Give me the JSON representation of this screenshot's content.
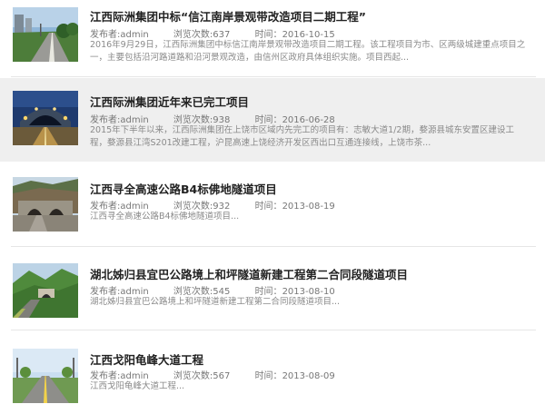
{
  "articles": [
    {
      "title": "江西际洲集团中标“信江南岸景观带改造项目二期工程”",
      "author_label": "发布者:",
      "author": "admin",
      "views_label": "浏览次数:",
      "views": "637",
      "time_label": "时间：",
      "date": "2016-10-15",
      "desc_line1": "2016年9月29日，江西际洲集团中标信江南岸景观带改造项目二期工程。该工程项目为市、区两级城建重点项目之",
      "desc_line2": "一，主要包括沿河路道路和沿河景观改造，由信州区政府具体组织实施。项目西起...",
      "thumb_icon": "boulevard-photo"
    },
    {
      "title": "江西际洲集团近年来已完工项目",
      "author_label": "发布者:",
      "author": "admin",
      "views_label": "浏览次数:",
      "views": "938",
      "time_label": "时间：",
      "date": "2016-06-28",
      "desc_line1": "2015年下半年以来，江西际洲集团在上饶市区域内先完工的项目有：志敏大道1/2期，婺源县城东安置区建设工",
      "desc_line2": "程，婺源县江湾S201改建工程，沪昆高速上饶经济开发区西出口互通连接线，上饶市茶...",
      "thumb_icon": "tunnel-night-photo"
    },
    {
      "title": "江西寻全高速公路B4标佛地隧道项目",
      "author_label": "发布者:",
      "author": "admin",
      "views_label": "浏览次数:",
      "views": "932",
      "time_label": "时间：",
      "date": "2013-08-19",
      "desc_line1": "江西寻全高速公路B4标佛地隧道项目...",
      "thumb_icon": "tunnel-portal-photo"
    },
    {
      "title": "湖北姊归县宜巴公路境上和坪隧道新建工程第二合同段隧道项目",
      "author_label": "发布者:",
      "author": "admin",
      "views_label": "浏览次数:",
      "views": "545",
      "time_label": "时间：",
      "date": "2013-08-10",
      "desc_line1": "湖北姊归县宜巴公路境上和坪隧道新建工程第二合同段隧道项目...",
      "thumb_icon": "mountain-road-photo"
    },
    {
      "title": "江西戈阳龟峰大道工程",
      "author_label": "发布者:",
      "author": "admin",
      "views_label": "浏览次数:",
      "views": "567",
      "time_label": "时间：",
      "date": "2013-08-09",
      "desc_line1": "江西戈阳龟峰大道工程...",
      "thumb_icon": "avenue-photo"
    }
  ]
}
